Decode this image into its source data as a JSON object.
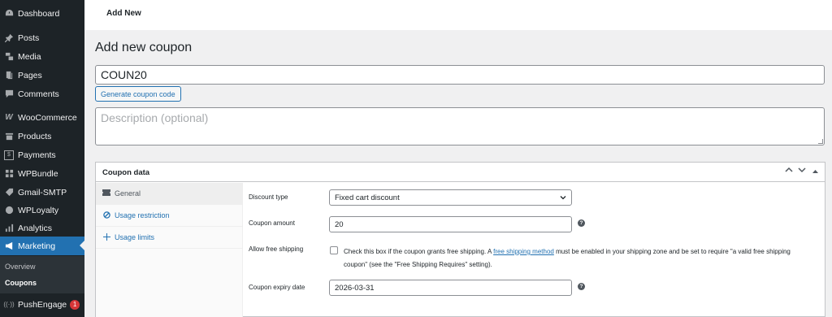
{
  "sidebar": {
    "items": [
      {
        "label": "Dashboard",
        "icon": "dashboard-icon"
      },
      {
        "label": "Posts",
        "icon": "pin-icon"
      },
      {
        "label": "Media",
        "icon": "media-icon"
      },
      {
        "label": "Pages",
        "icon": "pages-icon"
      },
      {
        "label": "Comments",
        "icon": "comment-icon"
      },
      {
        "label": "WooCommerce",
        "icon": "woocommerce-icon"
      },
      {
        "label": "Products",
        "icon": "archive-icon"
      },
      {
        "label": "Payments",
        "icon": "dollar-icon"
      },
      {
        "label": "WPBundle",
        "icon": "grid-icon"
      },
      {
        "label": "Gmail-SMTP",
        "icon": "tag-icon"
      },
      {
        "label": "WPLoyalty",
        "icon": "loyalty-icon"
      },
      {
        "label": "Analytics",
        "icon": "chart-icon"
      },
      {
        "label": "Marketing",
        "icon": "megaphone-icon"
      },
      {
        "label": "PushEngage",
        "icon": "broadcast-icon",
        "badge": "1"
      }
    ],
    "submenu": {
      "overview": "Overview",
      "coupons": "Coupons"
    }
  },
  "topbar": {
    "title": "Add New"
  },
  "page": {
    "title": "Add new coupon",
    "coupon_code": "COUN20",
    "generate_label": "Generate coupon code",
    "description_placeholder": "Description (optional)"
  },
  "coupon_data": {
    "heading": "Coupon data",
    "tabs": [
      {
        "label": "General",
        "icon": "ticket-icon"
      },
      {
        "label": "Usage restriction",
        "icon": "block-icon"
      },
      {
        "label": "Usage limits",
        "icon": "plus-icon"
      }
    ],
    "fields": {
      "discount_type_label": "Discount type",
      "discount_type_value": "Fixed cart discount",
      "amount_label": "Coupon amount",
      "amount_value": "20",
      "free_shipping_label": "Allow free shipping",
      "free_shipping_text_before": "Check this box if the coupon grants free shipping. A ",
      "free_shipping_link": "free shipping method",
      "free_shipping_text_after": " must be enabled in your shipping zone and be set to require \"a valid free shipping coupon\" (see the \"Free Shipping Requires\" setting).",
      "expiry_label": "Coupon expiry date",
      "expiry_value": "2026-03-31"
    }
  },
  "colors": {
    "sidebar_bg": "#1d2327",
    "accent": "#2271b1",
    "badge": "#d63638"
  }
}
